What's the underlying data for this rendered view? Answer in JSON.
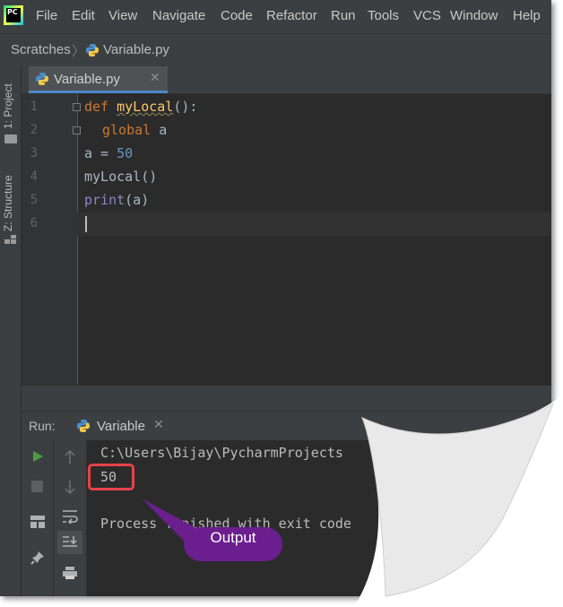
{
  "app": {
    "logo_text": "PC"
  },
  "menu": [
    "File",
    "Edit",
    "View",
    "Navigate",
    "Code",
    "Refactor",
    "Run",
    "Tools",
    "VCS",
    "Window",
    "Help"
  ],
  "breadcrumb": {
    "root": "Scratches",
    "separator": "〉",
    "file": "Variable.py"
  },
  "sidebar": {
    "project_tab": "1: Project",
    "structure_tab": "Z: Structure"
  },
  "editor": {
    "tab_label": "Variable.py",
    "tab_close": "✕",
    "line_numbers": [
      "1",
      "2",
      "3",
      "4",
      "5",
      "6"
    ],
    "code": {
      "l1_kw": "def",
      "l1_fn": "myLocal",
      "l1_rest": "():",
      "l2_kw": "global",
      "l2_rest": " a",
      "l3_lhs": "a = ",
      "l3_num": "50",
      "l4": "myLocal()",
      "l5_bi": "print",
      "l5_rest": "(a)"
    }
  },
  "run_panel": {
    "label": "Run:",
    "tab_label": "Variable",
    "tab_close": "✕",
    "console_lines": [
      "C:\\Users\\Bijay\\PycharmProjects",
      "50",
      "Process finished with exit code"
    ]
  },
  "annotation": {
    "label": "Output",
    "highlight_color": "#e8424a",
    "bubble_color": "#6b1f8f"
  },
  "colors": {
    "accent": "#4a88c7",
    "run_green": "#4e9a3f",
    "keyword": "#cc7832",
    "function": "#ffc66d",
    "number": "#6897bb",
    "builtin": "#8888c6"
  }
}
